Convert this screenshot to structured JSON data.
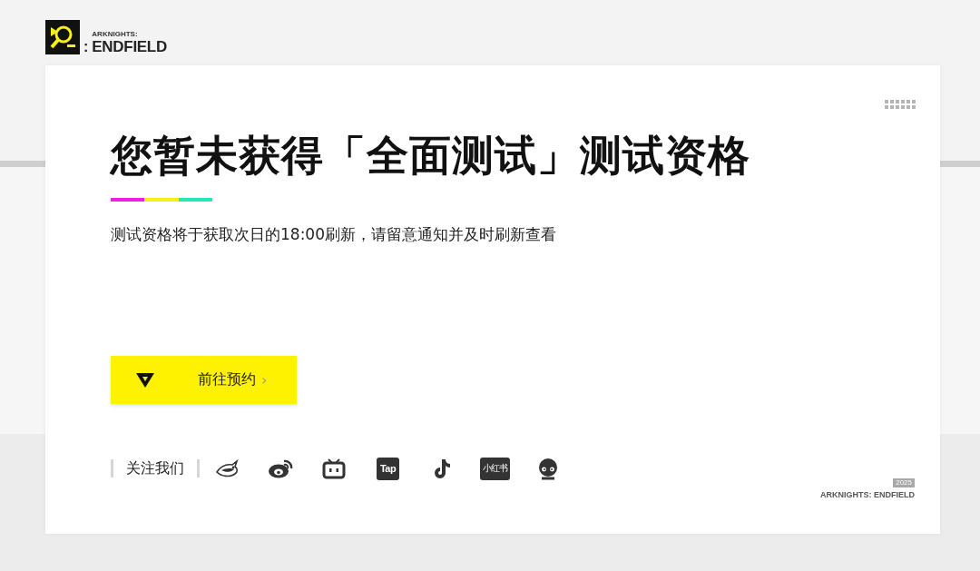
{
  "header": {
    "logo_small": "ARKNIGHTS:",
    "logo_large": "ENDFIELD",
    "logo_colon": ":"
  },
  "notice": {
    "title": "您暂未获得「全面测试」测试资格",
    "accent_stripes": [
      {
        "color": "#f01ee0"
      },
      {
        "color": "#f5ef1c"
      },
      {
        "color": "#20e8b8"
      }
    ],
    "message": "测试资格将于获取次日的18:00刷新，请留意通知并及时刷新查看"
  },
  "button": {
    "label": "前往预约",
    "chevron": "›"
  },
  "follow": {
    "label": "关注我们",
    "icons": [
      {
        "kind": "bird"
      },
      {
        "kind": "weibo"
      },
      {
        "kind": "tv"
      },
      {
        "kind": "tile",
        "text": "Tap"
      },
      {
        "kind": "note"
      },
      {
        "kind": "tile",
        "text": "小红书"
      },
      {
        "kind": "mascot"
      }
    ]
  },
  "footer": {
    "year": "2025",
    "brand": "ARKNIGHTS: ENDFIELD"
  }
}
